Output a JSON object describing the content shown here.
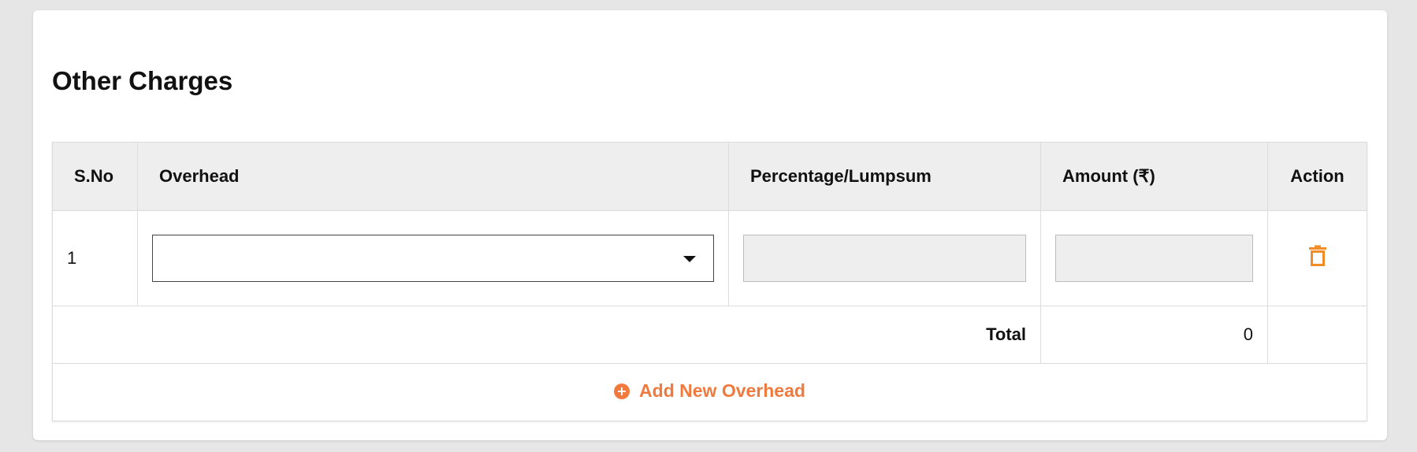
{
  "section": {
    "title": "Other Charges"
  },
  "table": {
    "headers": {
      "sno": "S.No",
      "overhead": "Overhead",
      "percentage": "Percentage/Lumpsum",
      "amount": "Amount (₹)",
      "action": "Action"
    },
    "rows": [
      {
        "sno": "1",
        "overhead": "",
        "percentage": "",
        "amount": ""
      }
    ],
    "total": {
      "label": "Total",
      "value": "0"
    }
  },
  "actions": {
    "add_label": "Add New Overhead"
  },
  "icons": {
    "delete": "trash-icon",
    "add": "plus-circle-icon",
    "dropdown": "chevron-down-icon"
  },
  "colors": {
    "accent": "#f07a3e",
    "delete_icon": "#f28c28",
    "header_bg": "#eeeeee"
  }
}
